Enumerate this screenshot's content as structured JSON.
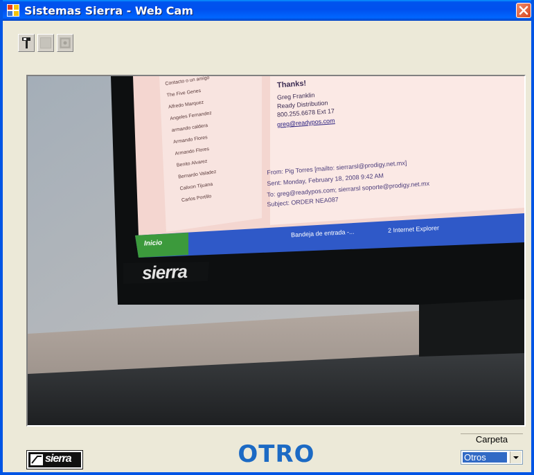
{
  "window": {
    "title": "Sistemas Sierra - Web Cam"
  },
  "toolbar": {
    "buttons": [
      "hammer-icon",
      "capture-icon",
      "image-icon"
    ]
  },
  "video": {
    "screen_text": {
      "thanks": "Thanks!",
      "sig_name": "Greg Franklin",
      "sig_company": "Ready Distribution",
      "sig_phone": "800.255.6678 Ext 17",
      "sig_email": "greg@readypos.com",
      "from": "From: Pig Torres [mailto: sierrarsl@prodigy.net.mx]",
      "sent": "Sent: Monday, February 18, 2008 9:42 AM",
      "to": "To: greg@readypos.com; sierrarsl soporte@prodigy.net.mx",
      "subject": "Subject: ORDER NEA087",
      "start": "Inicio",
      "task1": "Bandeja de entrada -...",
      "task2": "2 Internet Explorer",
      "contacts": [
        "Contacto o un amigo",
        "The Five Genes",
        "Alfredo Marquez",
        "Angeles Fernandez",
        "armando caldera",
        "Armando Flores",
        "Armando Flores",
        "Benito Alvarez",
        "Bernardo Valadez",
        "Calixon Tijuana",
        "Carlos Portillo"
      ],
      "monitor_brand": "sierra"
    }
  },
  "footer": {
    "logo_text": "sierra",
    "status_text": "OTRO",
    "folder_label": "Carpeta",
    "folder_value": "Otros"
  }
}
